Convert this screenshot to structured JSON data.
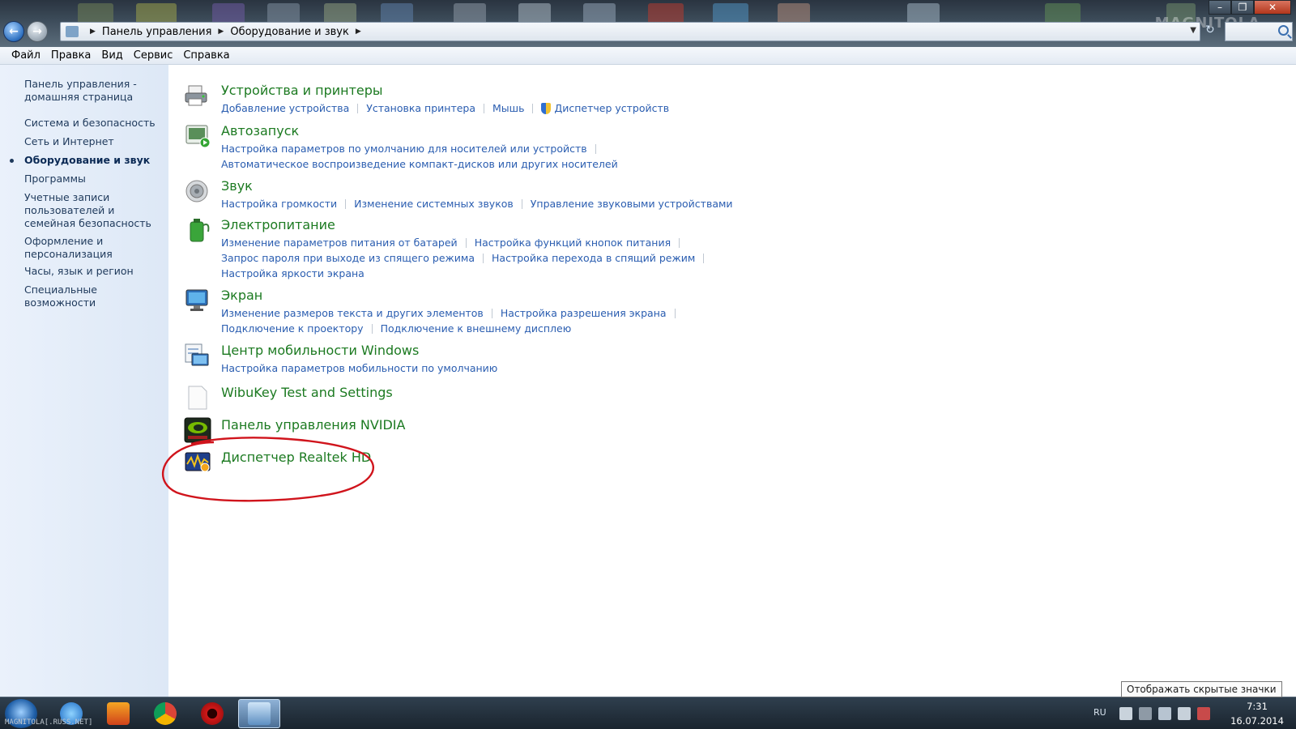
{
  "window": {
    "breadcrumb": [
      "Панель управления",
      "Оборудование и звук"
    ],
    "watermark": "MAGNITOLA",
    "controls": {
      "minimize": "–",
      "maximize": "❐",
      "close": "✕"
    }
  },
  "menu": [
    "Файл",
    "Правка",
    "Вид",
    "Сервис",
    "Справка"
  ],
  "sidebar": {
    "items": [
      {
        "label": "Панель управления - домашняя страница",
        "active": false
      },
      {
        "label": "Система и безопасность",
        "active": false
      },
      {
        "label": "Сеть и Интернет",
        "active": false
      },
      {
        "label": "Оборудование и звук",
        "active": true
      },
      {
        "label": "Программы",
        "active": false
      },
      {
        "label": "Учетные записи пользователей и семейная безопасность",
        "active": false
      },
      {
        "label": "Оформление и персонализация",
        "active": false
      },
      {
        "label": "Часы, язык и регион",
        "active": false
      },
      {
        "label": "Специальные возможности",
        "active": false
      }
    ]
  },
  "categories": [
    {
      "title": "Устройства и принтеры",
      "icon": "printer-icon",
      "links": [
        [
          "Добавление устройства",
          "Установка принтера",
          "Мышь",
          "Диспетчер устройств"
        ]
      ]
    },
    {
      "title": "Автозапуск",
      "icon": "autoplay-icon",
      "links": [
        [
          "Настройка параметров по умолчанию для носителей или устройств"
        ],
        [
          "Автоматическое воспроизведение компакт-дисков или других носителей"
        ]
      ]
    },
    {
      "title": "Звук",
      "icon": "speaker-icon",
      "links": [
        [
          "Настройка громкости",
          "Изменение системных звуков",
          "Управление звуковыми устройствами"
        ]
      ]
    },
    {
      "title": "Электропитание",
      "icon": "battery-icon",
      "links": [
        [
          "Изменение параметров питания от батарей",
          "Настройка функций кнопок питания"
        ],
        [
          "Запрос пароля при выходе из спящего режима",
          "Настройка перехода в спящий режим"
        ],
        [
          "Настройка яркости экрана"
        ]
      ]
    },
    {
      "title": "Экран",
      "icon": "monitor-icon",
      "links": [
        [
          "Изменение размеров текста и других элементов",
          "Настройка разрешения экрана"
        ],
        [
          "Подключение к проектору",
          "Подключение к внешнему дисплею"
        ]
      ]
    },
    {
      "title": "Центр мобильности Windows",
      "icon": "mobility-center-icon",
      "links": [
        [
          "Настройка параметров мобильности по умолчанию"
        ]
      ]
    },
    {
      "title": "WibuKey Test and Settings",
      "icon": "document-icon",
      "links": []
    },
    {
      "title": "Панель управления NVIDIA",
      "icon": "nvidia-icon",
      "links": []
    },
    {
      "title": "Диспетчер Realtek HD",
      "icon": "realtek-icon",
      "links": []
    }
  ],
  "taskbar": {
    "apps": [
      "internet-explorer-icon",
      "media-player-icon",
      "chrome-icon",
      "opera-icon",
      "control-panel-icon"
    ],
    "caption": "MAGNITOLA[.RUSS.NET]",
    "language": "RU",
    "time": "7:31",
    "date": "16.07.2014"
  },
  "tooltip": "Отображать скрытые значки",
  "colors": {
    "title_green": "#1c7a21",
    "link_blue": "#2a5db0",
    "highlight_red": "#d0141c"
  }
}
